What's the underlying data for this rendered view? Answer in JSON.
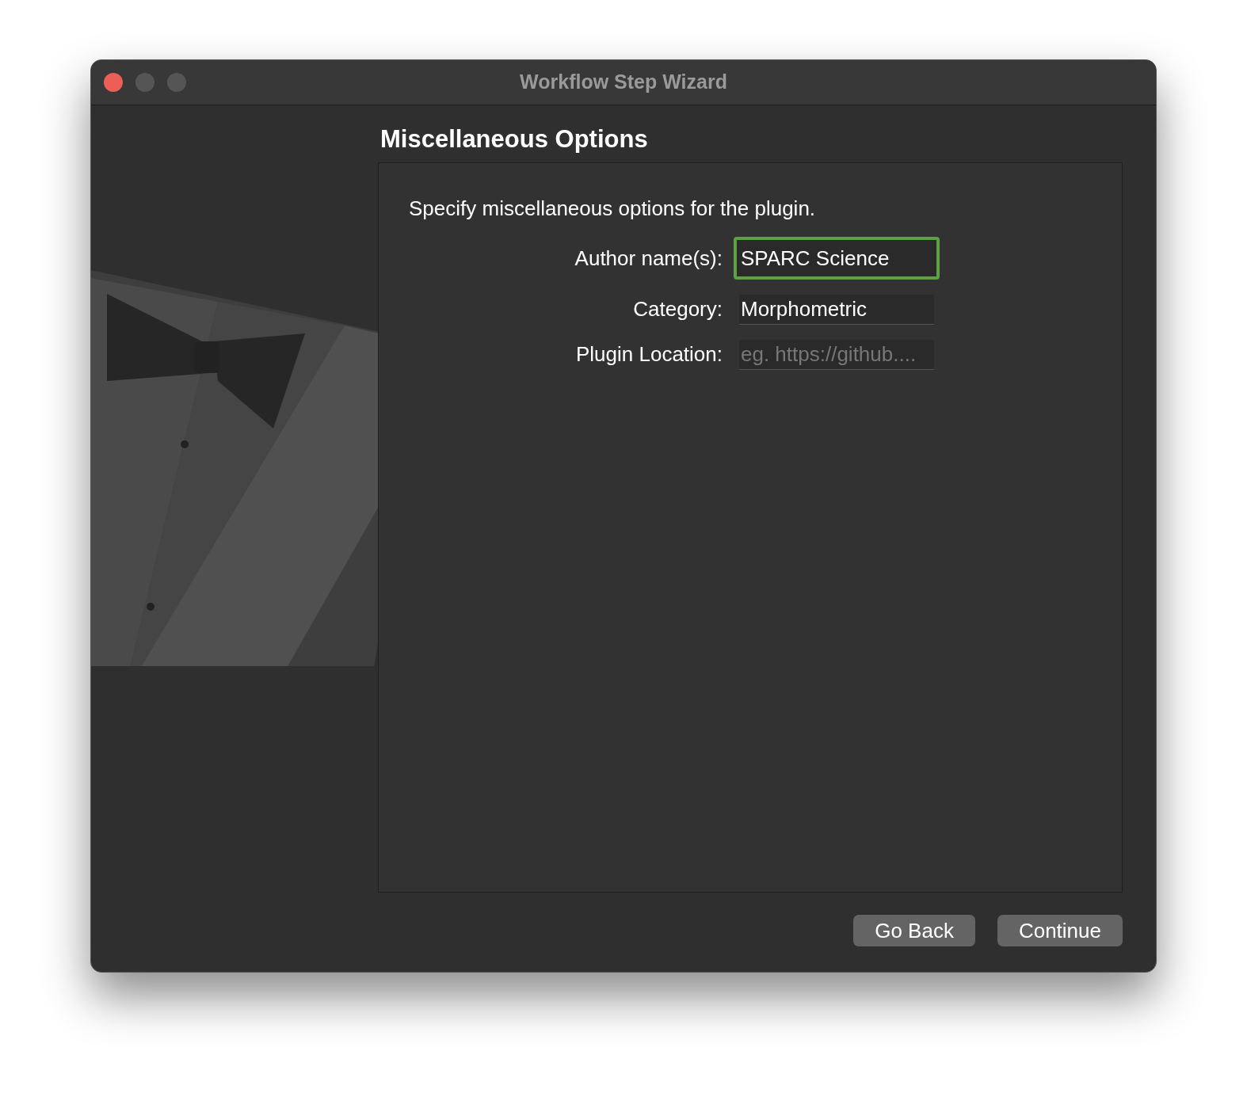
{
  "window": {
    "title": "Workflow Step Wizard"
  },
  "heading": "Miscellaneous Options",
  "description": "Specify miscellaneous options for the plugin.",
  "fields": [
    {
      "label": "Author name(s):",
      "value": "SPARC Science",
      "focused": true
    },
    {
      "label": "Category:",
      "value": "Morphometric",
      "focused": false
    },
    {
      "label": "Plugin Location:",
      "placeholder": "eg. https://github....",
      "focused": false
    }
  ],
  "buttons": [
    "Go Back",
    "Continue"
  ]
}
